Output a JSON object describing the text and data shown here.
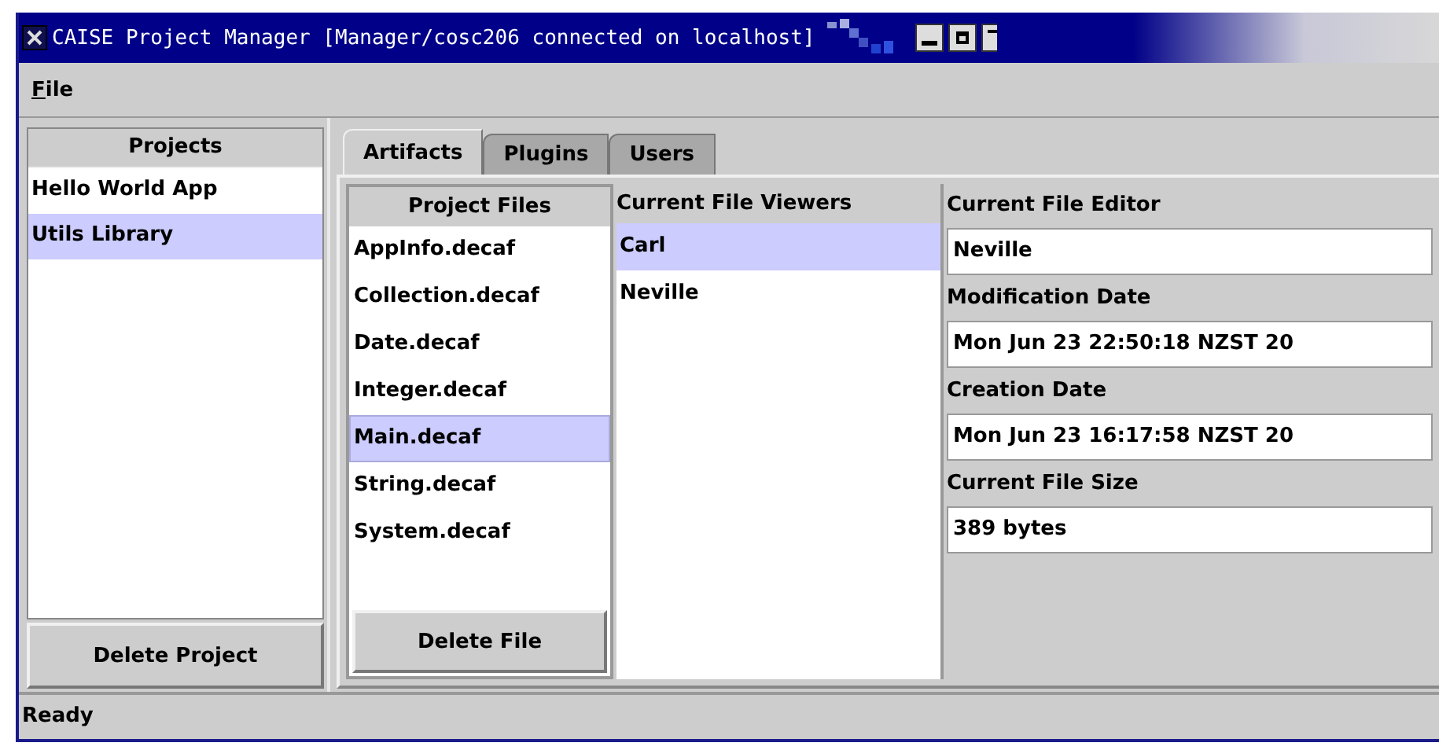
{
  "window": {
    "title": "CAISE Project Manager [Manager/cosc206 connected on localhost]"
  },
  "menu": [
    {
      "label": "File"
    }
  ],
  "projects": {
    "header": "Projects",
    "items": [
      {
        "label": "Hello World App",
        "selected": false
      },
      {
        "label": "Utils Library",
        "selected": true
      }
    ],
    "button": "Delete Project"
  },
  "tabs": [
    {
      "label": "Artifacts",
      "selected": true
    },
    {
      "label": "Plugins",
      "selected": false
    },
    {
      "label": "Users",
      "selected": false
    }
  ],
  "files": {
    "header": "Project Files",
    "items": [
      {
        "label": "AppInfo.decaf",
        "selected": false
      },
      {
        "label": "Collection.decaf",
        "selected": false
      },
      {
        "label": "Date.decaf",
        "selected": false
      },
      {
        "label": "Integer.decaf",
        "selected": false
      },
      {
        "label": "Main.decaf",
        "selected": true
      },
      {
        "label": "String.decaf",
        "selected": false
      },
      {
        "label": "System.decaf",
        "selected": false
      }
    ],
    "button": "Delete File"
  },
  "viewers": {
    "header": "Current File Viewers",
    "items": [
      {
        "label": "Carl",
        "selected": true
      },
      {
        "label": "Neville",
        "selected": false
      }
    ]
  },
  "details": [
    {
      "label": "Current File Editor",
      "value": "Neville"
    },
    {
      "label": "Modification Date",
      "value": "Mon Jun 23 22:50:18 NZST 20"
    },
    {
      "label": "Creation Date",
      "value": "Mon Jun 23 16:17:58 NZST 20"
    },
    {
      "label": "Current File Size",
      "value": "389 bytes"
    }
  ],
  "status_bar": "Ready"
}
